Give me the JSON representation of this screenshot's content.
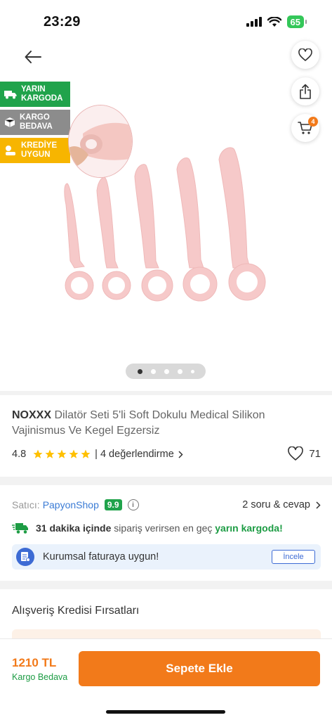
{
  "status": {
    "time": "23:29",
    "battery": "65"
  },
  "header": {
    "cart_count": "4"
  },
  "badges": [
    {
      "line1": "YARIN",
      "line2": "KARGODA",
      "color": "#20a34b"
    },
    {
      "line1": "KARGO",
      "line2": "BEDAVA",
      "color": "#8c8c8c"
    },
    {
      "line1": "KREDİYE",
      "line2": "UYGUN",
      "color": "#f7b500"
    }
  ],
  "product": {
    "brand": "NOXXX",
    "name": "Dilatör Seti 5'li Soft Dokulu Medical Silikon Vajinismus Ve Kegel Egzersiz",
    "rating": "4.8",
    "reviews": "| 4 değerlendirme",
    "favorites": "71"
  },
  "seller": {
    "label": "Satıcı:",
    "name": "PapyonShop",
    "score": "9.9",
    "qa": "2 soru & cevap"
  },
  "shipping": {
    "bold": "31 dakika içinde",
    "middle": " sipariş verirsen en geç ",
    "green": "yarın kargoda!"
  },
  "corporate": {
    "text": "Kurumsal faturaya uygun!",
    "button": "İncele"
  },
  "credit": {
    "title": "Alışveriş Kredisi Fırsatları"
  },
  "footer": {
    "price": "1210 TL",
    "shipping": "Kargo Bedava",
    "add_to_cart": "Sepete Ekle"
  },
  "colors": {
    "accent": "#f27a1a",
    "green": "#1d9c44",
    "blue": "#3a7bd5",
    "pink": "#f6c9c9"
  }
}
